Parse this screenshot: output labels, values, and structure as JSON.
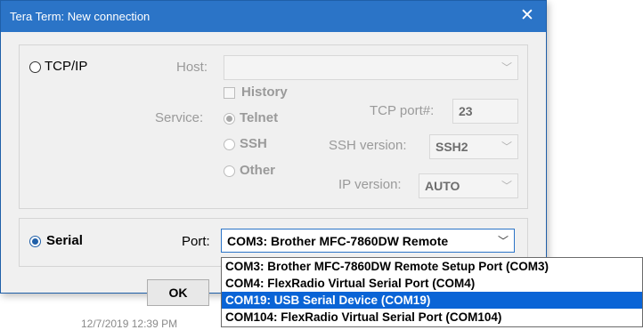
{
  "window": {
    "title": "Tera Term: New connection",
    "close_glyph": "✕"
  },
  "tcpip": {
    "label": "TCP/IP",
    "host_label": "Host:",
    "host_value": "",
    "history_label": "History",
    "service_label": "Service:",
    "service_options": [
      "Telnet",
      "SSH",
      "Other"
    ],
    "service_selected": "Telnet",
    "tcp_port_label": "TCP port#:",
    "tcp_port_value": "23",
    "ssh_version_label": "SSH version:",
    "ssh_version_value": "SSH2",
    "ip_version_label": "IP version:",
    "ip_version_value": "AUTO"
  },
  "serial": {
    "label": "Serial",
    "port_label": "Port:",
    "port_value": "COM3: Brother MFC-7860DW Remote",
    "port_options": [
      "COM3: Brother MFC-7860DW Remote Setup Port (COM3)",
      "COM4: FlexRadio Virtual Serial Port (COM4)",
      "COM19: USB Serial Device (COM19)",
      "COM104: FlexRadio Virtual Serial Port (COM104)"
    ],
    "highlighted_option": "COM19: USB Serial Device (COM19)"
  },
  "buttons": {
    "ok_label": "OK"
  },
  "background": {
    "date_text": "12/7/2019 12:39 PM"
  },
  "colors": {
    "title_bar": "#2b74c7",
    "selection": "#0a64d6"
  }
}
